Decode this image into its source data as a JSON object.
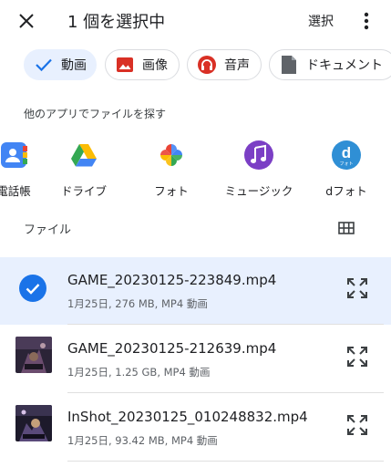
{
  "appbar": {
    "title": "1 個を選択中",
    "select_label": "選択"
  },
  "chips": [
    {
      "label": "動画",
      "icon": "check-icon",
      "selected": true
    },
    {
      "label": "画像",
      "icon": "image-icon",
      "selected": false
    },
    {
      "label": "音声",
      "icon": "headphones-icon",
      "selected": false
    },
    {
      "label": "ドキュメント",
      "icon": "document-icon",
      "selected": false
    }
  ],
  "other_apps": {
    "label": "他のアプリでファイルを探す",
    "apps": [
      {
        "name": "電話帳",
        "icon": "contacts-icon"
      },
      {
        "name": "ドライブ",
        "icon": "google-drive-icon"
      },
      {
        "name": "フォト",
        "icon": "google-photos-icon"
      },
      {
        "name": "ミュージック",
        "icon": "music-icon"
      },
      {
        "name": "dフォト",
        "icon": "d-photo-icon",
        "icon_text": "d",
        "icon_subtext": "フォト"
      }
    ]
  },
  "files": {
    "header": "ファイル",
    "items": [
      {
        "name": "GAME_20230125-223849.mp4",
        "meta": "1月25日, 276 MB, MP4 動画",
        "selected": true
      },
      {
        "name": "GAME_20230125-212639.mp4",
        "meta": "1月25日, 1.25 GB, MP4 動画",
        "selected": false
      },
      {
        "name": "InShot_20230125_010248832.mp4",
        "meta": "1月25日, 93.42 MB, MP4 動画",
        "selected": false
      }
    ]
  },
  "colors": {
    "accent": "#1a73e8",
    "selected_bg": "#e8f0fe",
    "image_icon": "#d93025",
    "audio_icon": "#d93025",
    "document_icon": "#5f6368",
    "music_app": "#7b3fc5",
    "d_photo_app": "#2f8fd5"
  }
}
